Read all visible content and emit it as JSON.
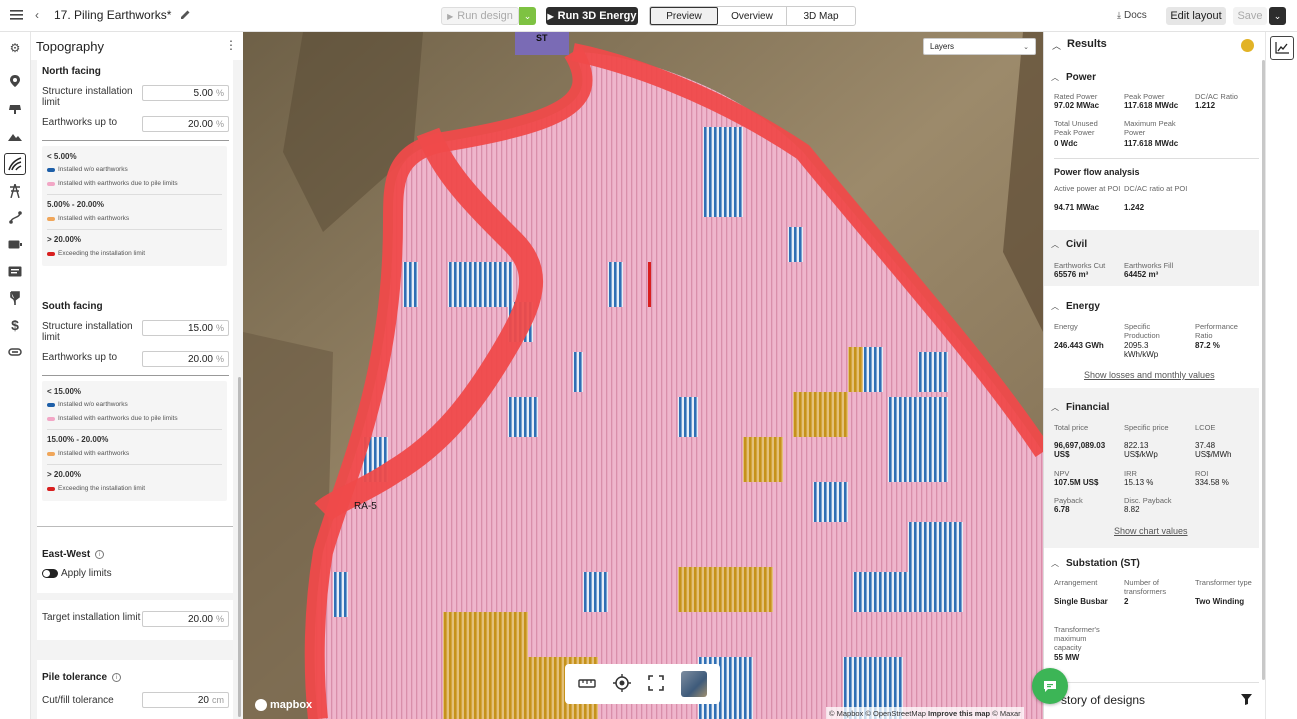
{
  "app": {
    "title": "17. Piling Earthworks*"
  },
  "toolbar": {
    "run_design": "Run design",
    "run_3d": "Run 3D Energy",
    "tabs": [
      "Preview",
      "Overview",
      "3D Map"
    ],
    "docs": "Docs",
    "edit_layout": "Edit layout",
    "save": "Save"
  },
  "left": {
    "title": "Topography",
    "north": {
      "heading": "North facing",
      "structure_label": "Structure installation limit",
      "structure_value": "5.00",
      "earth_label": "Earthworks up to",
      "earth_value": "20.00",
      "unit": "%",
      "legend": {
        "g1": "< 5.00%",
        "g1_i1": "Installed w/o earthworks",
        "g1_i2": "Installed with earthworks due to pile limits",
        "g2": "5.00% - 20.00%",
        "g2_i1": "Installed with earthworks",
        "g3": "> 20.00%",
        "g3_i1": "Exceeding the installation limit"
      }
    },
    "south": {
      "heading": "South facing",
      "structure_label": "Structure installation limit",
      "structure_value": "15.00",
      "earth_label": "Earthworks up to",
      "earth_value": "20.00",
      "unit": "%",
      "legend": {
        "g1": "< 15.00%",
        "g1_i1": "Installed w/o earthworks",
        "g1_i2": "Installed with earthworks due to pile limits",
        "g2": "15.00% - 20.00%",
        "g2_i1": "Installed with earthworks",
        "g3": "> 20.00%",
        "g3_i1": "Exceeding the installation limit"
      }
    },
    "east_west": {
      "heading": "East-West",
      "toggle_label": "Apply limits",
      "target_label": "Target installation limit",
      "target_value": "20.00",
      "unit": "%"
    },
    "pile": {
      "heading": "Pile tolerance",
      "cutfill_label": "Cut/fill tolerance",
      "cutfill_value": "20",
      "unit": "cm"
    },
    "colors": {
      "blue": "#1e5fa8",
      "pink": "#f2a7c6",
      "orange": "#f0a65a",
      "red": "#d81f1f"
    }
  },
  "map": {
    "layers": "Layers",
    "label_st": "ST",
    "label_ra": "RA-5",
    "attribution": "© Mapbox © OpenStreetMap",
    "improve": "Improve this map",
    "maxar": "© Maxar",
    "logo": "mapbox"
  },
  "results": {
    "title": "Results",
    "power": {
      "heading": "Power",
      "rated_label": "Rated Power",
      "rated_value": "97.02 MWac",
      "peak_label": "Peak Power",
      "peak_value": "117.618 MWdc",
      "dcac_label": "DC/AC Ratio",
      "dcac_value": "1.212",
      "unused_label": "Total Unused Peak Power",
      "unused_value": "0 Wdc",
      "maxpeak_label": "Maximum Peak Power",
      "maxpeak_value": "117.618 MWdc"
    },
    "flow": {
      "heading": "Power flow analysis",
      "active_label": "Active power at POI",
      "active_value": "94.71 MWac",
      "ratio_label": "DC/AC ratio at POI",
      "ratio_value": "1.242"
    },
    "civil": {
      "heading": "Civil",
      "cut_label": "Earthworks Cut",
      "cut_value": "65576 m³",
      "fill_label": "Earthworks Fill",
      "fill_value": "64452 m³"
    },
    "energy": {
      "heading": "Energy",
      "energy_label": "Energy",
      "energy_value": "246.443 GWh",
      "spec_label": "Specific Production",
      "spec_value": "2095.3 kWh/kWp",
      "pr_label": "Performance Ratio",
      "pr_value": "87.2 %",
      "link": "Show losses and monthly values"
    },
    "financial": {
      "heading": "Financial",
      "total_label": "Total price",
      "total_value": "96,697,089.03 US$",
      "specp_label": "Specific price",
      "specp_value": "822.13 US$/kWp",
      "lcoe_label": "LCOE",
      "lcoe_value": "37.48 US$/MWh",
      "npv_label": "NPV",
      "npv_value": "107.5M US$",
      "irr_label": "IRR",
      "irr_value": "15.13 %",
      "roi_label": "ROI",
      "roi_value": "334.58 %",
      "payback_label": "Payback",
      "payback_value": "6.78",
      "disc_label": "Disc. Payback",
      "disc_value": "8.82",
      "link": "Show chart values"
    },
    "substation": {
      "heading": "Substation (ST)",
      "arr_label": "Arrangement",
      "arr_value": "Single Busbar",
      "num_label": "Number of transformers",
      "num_value": "2",
      "type_label": "Transformer type",
      "type_value": "Two Winding",
      "cap_label": "Transformer's maximum capacity",
      "cap_value": "55 MW"
    },
    "history": "story of designs"
  }
}
